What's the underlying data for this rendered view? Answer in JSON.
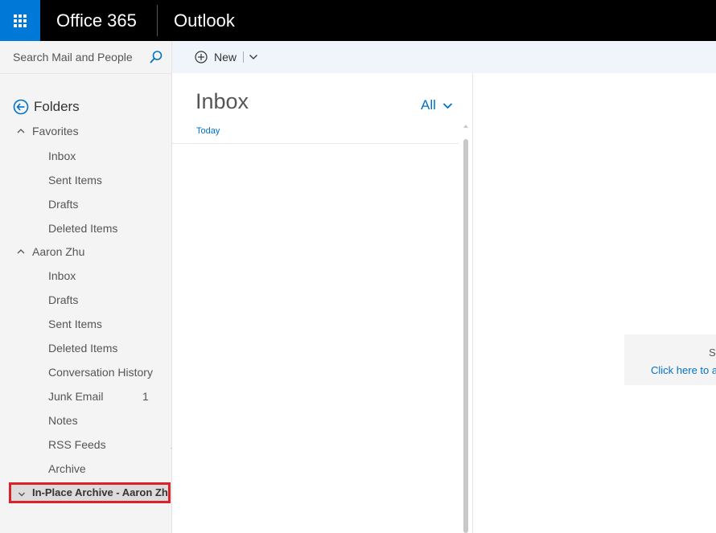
{
  "topbar": {
    "brand": "Office 365",
    "app_name": "Outlook"
  },
  "search": {
    "placeholder": "Search Mail and People",
    "icon": "search-icon"
  },
  "nav": {
    "folders_label": "Folders",
    "favorites": {
      "label": "Favorites",
      "items": [
        {
          "label": "Inbox"
        },
        {
          "label": "Sent Items"
        },
        {
          "label": "Drafts"
        },
        {
          "label": "Deleted Items"
        }
      ]
    },
    "account": {
      "label": "Aaron Zhu",
      "items": [
        {
          "label": "Inbox"
        },
        {
          "label": "Drafts"
        },
        {
          "label": "Sent Items"
        },
        {
          "label": "Deleted Items"
        },
        {
          "label": "Conversation History"
        },
        {
          "label": "Junk Email",
          "count": "1"
        },
        {
          "label": "Notes"
        },
        {
          "label": "RSS Feeds"
        },
        {
          "label": "Archive"
        }
      ]
    },
    "archive": {
      "label": "In-Place Archive - Aaron Zhu"
    }
  },
  "command_bar": {
    "new_label": "New"
  },
  "message_list": {
    "title": "Inbox",
    "filter_label": "All",
    "group_label": "Today"
  },
  "reading_pane": {
    "line1": "Se",
    "line2": "Click here to a"
  },
  "colors": {
    "accent": "#0078d7",
    "link": "#0072c6",
    "highlight_border": "#d9222a",
    "topbar": "#000000"
  }
}
